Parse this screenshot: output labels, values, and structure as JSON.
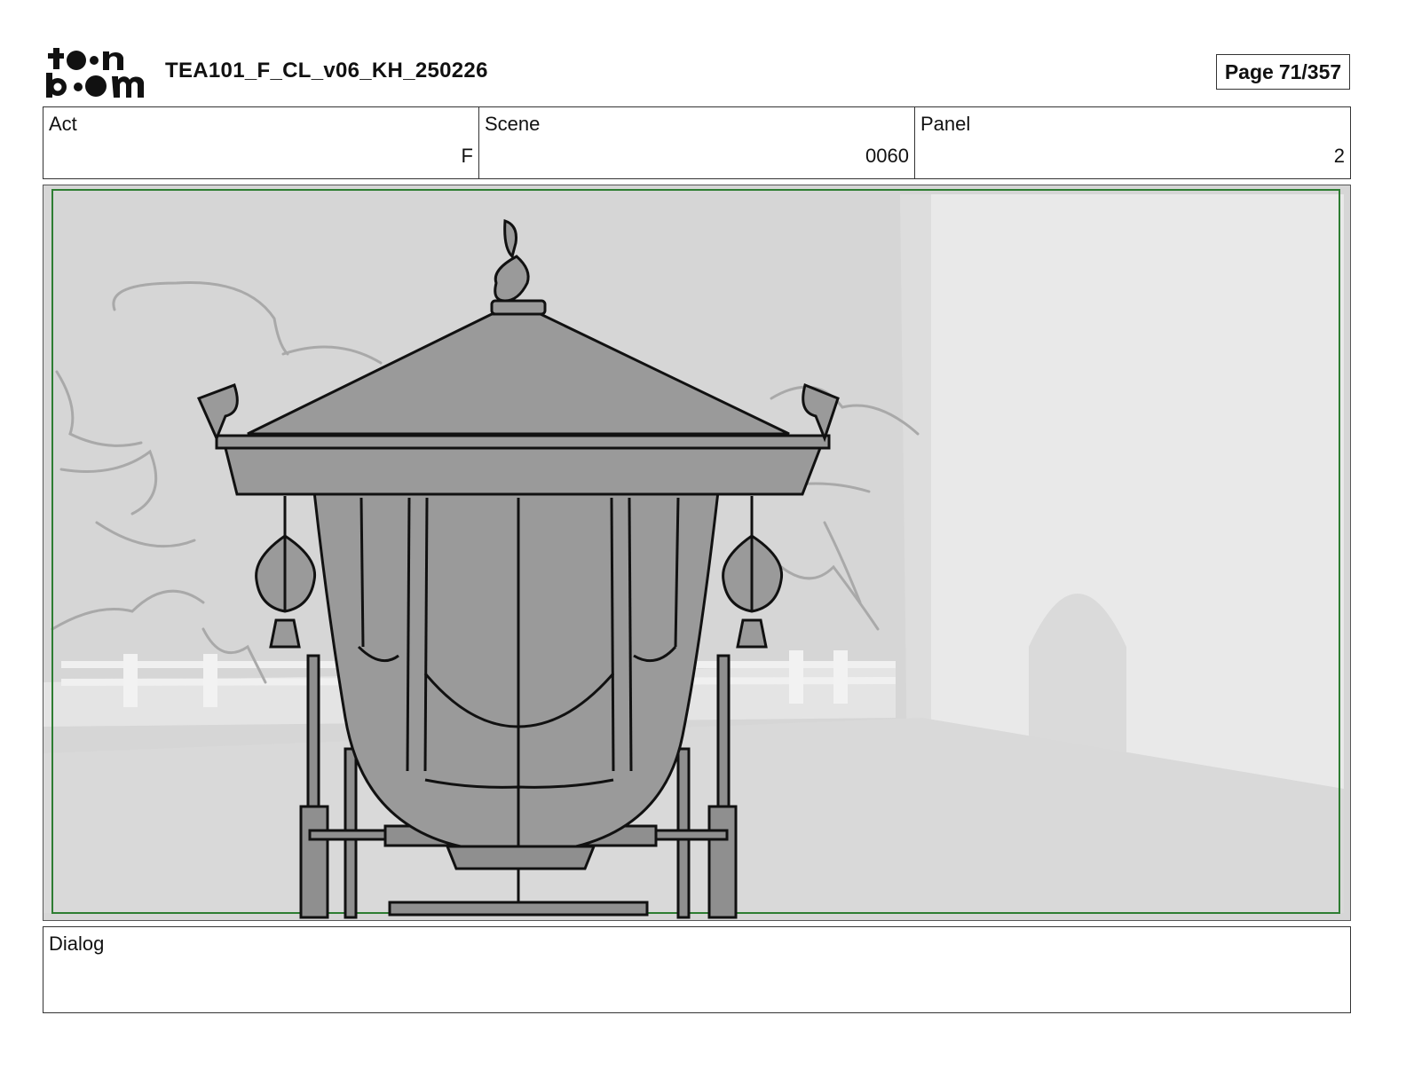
{
  "header": {
    "logo_top": "to•n",
    "logo_bottom": "b••m",
    "logo_icon": "toonboom-logo",
    "document_title": "TEA101_F_CL_v06_KH_250226",
    "page_label": "Page",
    "page_number": "71/357"
  },
  "info": {
    "act_label": "Act",
    "act_value": "F",
    "scene_label": "Scene",
    "scene_value": "0060",
    "panel_label": "Panel",
    "panel_value": "2"
  },
  "panel": {
    "frame_color": "#2e7d32",
    "description_icon": "ornate-carriage-sketch"
  },
  "dialog": {
    "label": "Dialog",
    "text": ""
  }
}
